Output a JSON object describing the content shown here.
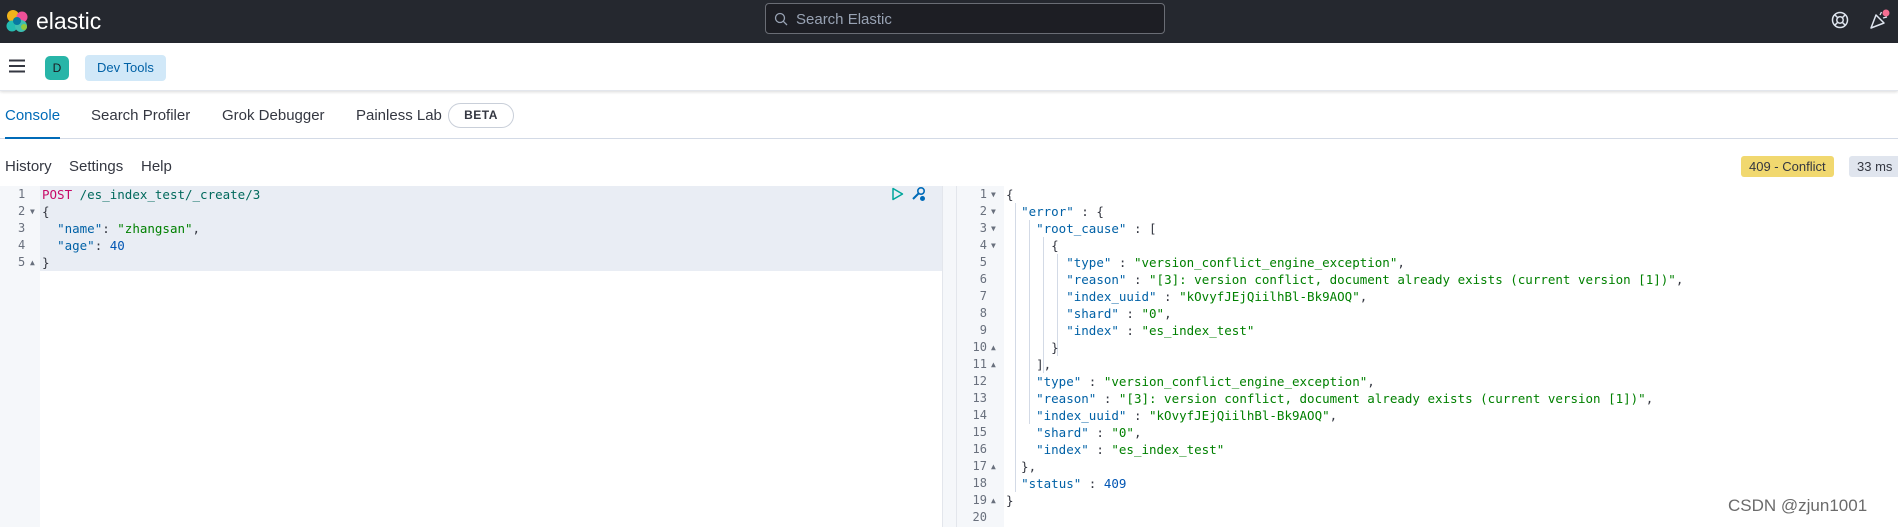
{
  "header": {
    "brand": "elastic",
    "search_placeholder": "Search Elastic"
  },
  "navbar": {
    "avatar_letter": "D",
    "breadcrumb": "Dev Tools"
  },
  "tabs": [
    {
      "label": "Console",
      "active": true
    },
    {
      "label": "Search Profiler",
      "active": false
    },
    {
      "label": "Grok Debugger",
      "active": false
    },
    {
      "label": "Painless Lab",
      "active": false
    }
  ],
  "beta_badge": "BETA",
  "console_menu": {
    "history": "History",
    "settings": "Settings",
    "help": "Help"
  },
  "response_status": {
    "status": "409 - Conflict",
    "time": "33 ms",
    "status_color": "#f1d86f"
  },
  "request": {
    "method": "POST",
    "url": " /es_index_test/_create/3",
    "lines": [
      "1",
      "2",
      "3",
      "4",
      "5"
    ],
    "body_open": "{",
    "name_key": "\"name\"",
    "name_value": "\"zhangsan\"",
    "age_key": "\"age\"",
    "age_value": "40",
    "body_close": "}"
  },
  "response": {
    "line_numbers": [
      "1",
      "2",
      "3",
      "4",
      "5",
      "6",
      "7",
      "8",
      "9",
      "10",
      "11",
      "12",
      "13",
      "14",
      "15",
      "16",
      "17",
      "18",
      "19",
      "20"
    ],
    "open": "{",
    "error_key": "\"error\"",
    "root_cause_key": "\"root_cause\"",
    "type_key": "\"type\"",
    "type_value": "\"version_conflict_engine_exception\"",
    "reason_key": "\"reason\"",
    "reason_value": "\"[3]: version conflict, document already exists (current version [1])\"",
    "index_uuid_key": "\"index_uuid\"",
    "index_uuid_value": "\"kOvyfJEjQiilhBl-Bk9AOQ\"",
    "shard_key": "\"shard\"",
    "shard_value": "\"0\"",
    "index_key": "\"index\"",
    "index_value": "\"es_index_test\"",
    "status_key": "\"status\"",
    "status_value": "409",
    "close": "}"
  },
  "watermark": "CSDN @zjun1001"
}
